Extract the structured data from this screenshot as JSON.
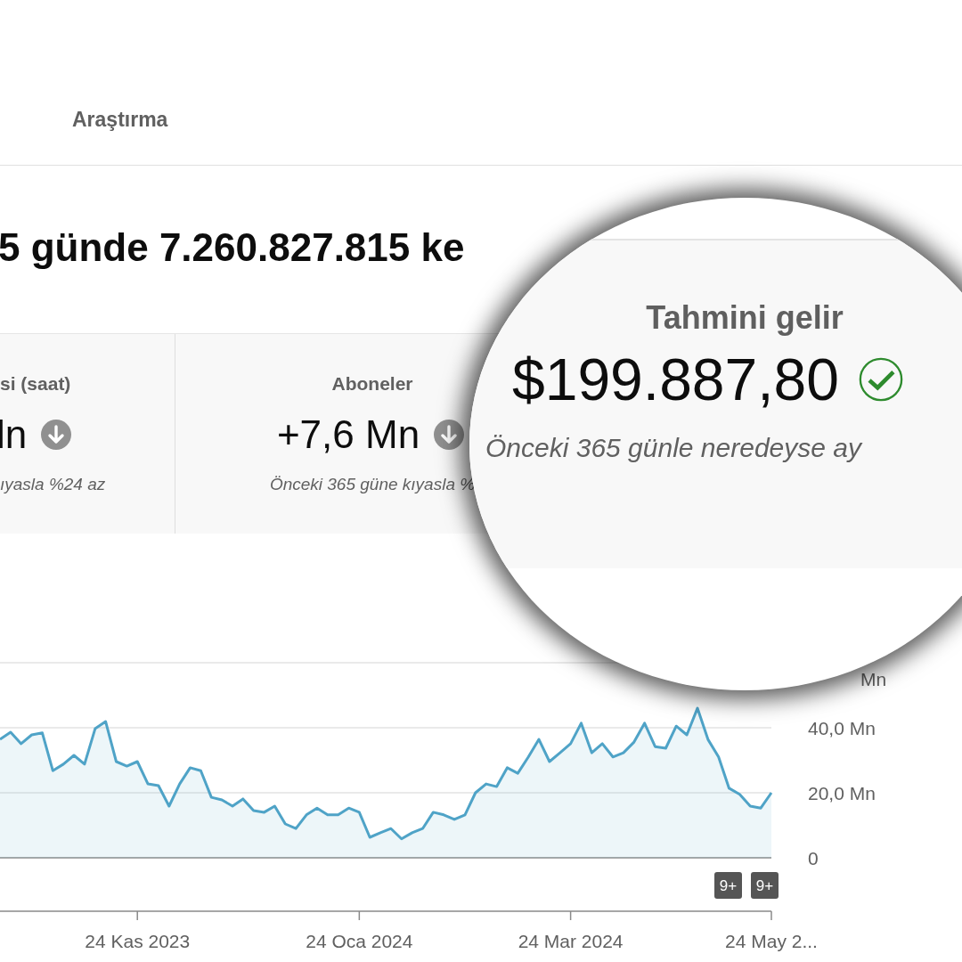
{
  "tabs": [
    {
      "label": "Araştırma",
      "selected": false
    }
  ],
  "heading": "5 günde 7.260.827.815 ke",
  "cards": [
    {
      "title": "si (saat)",
      "value": "ln",
      "kind": "down",
      "comparison": "ıyasla %24 az"
    },
    {
      "title": "Aboneler",
      "value": "+7,6 Mn",
      "kind": "down",
      "comparison": "Önceki 365 güne kıyasla %"
    }
  ],
  "magnifier": {
    "title": "Tahmini gelir",
    "value": "$199.887,80",
    "kind": "ok",
    "comparison": "Önceki 365 günle neredeyse ay"
  },
  "chart": {
    "covered_tick_label": "Mn",
    "badges": [
      "9+",
      "9+"
    ],
    "chart_data": {
      "type": "area",
      "categories": [
        null,
        null,
        null,
        null,
        null,
        null,
        null,
        null,
        null,
        null,
        null,
        null,
        null,
        "24 Kas 2023",
        null,
        null,
        null,
        null,
        null,
        null,
        null,
        null,
        null,
        null,
        null,
        null,
        null,
        null,
        null,
        null,
        null,
        null,
        null,
        null,
        "24 Oca 2024",
        null,
        null,
        null,
        null,
        null,
        null,
        null,
        null,
        null,
        null,
        null,
        null,
        null,
        null,
        null,
        null,
        null,
        null,
        null,
        "24 Mar 2024",
        null,
        null,
        null,
        null,
        null,
        null,
        null,
        null,
        null,
        null,
        null,
        null,
        null,
        null,
        null,
        null,
        null,
        null,
        "24 May 2..."
      ],
      "series": [
        {
          "color": "#4fa3c7",
          "values": [
            36.4,
            38.6,
            35.1,
            37.8,
            38.4,
            26.8,
            28.8,
            31.5,
            28.8,
            39.7,
            41.9,
            29.6,
            28.2,
            29.6,
            22.7,
            22.2,
            15.9,
            22.7,
            27.7,
            26.8,
            18.6,
            17.8,
            15.9,
            18.1,
            14.5,
            14.0,
            15.9,
            10.4,
            9.0,
            13.2,
            15.3,
            13.2,
            13.2,
            15.3,
            14.0,
            6.3,
            7.7,
            9.0,
            5.8,
            7.7,
            9.0,
            14.0,
            13.2,
            11.8,
            13.2,
            20.0,
            22.7,
            21.9,
            27.7,
            26.0,
            31.0,
            36.4,
            29.6,
            32.3,
            35.1,
            41.4,
            32.3,
            35.1,
            31.0,
            32.3,
            35.6,
            41.4,
            34.2,
            33.7,
            40.5,
            37.8,
            46.0,
            36.4,
            31.0,
            21.4,
            19.5,
            15.9,
            15.3,
            20.0
          ]
        }
      ],
      "ylim": [
        0,
        60
      ],
      "yticks": [
        {
          "value": 0,
          "label": "0"
        },
        {
          "value": 20,
          "label": "20,0 Mn"
        },
        {
          "value": 40,
          "label": "40,0 Mn"
        }
      ]
    }
  }
}
